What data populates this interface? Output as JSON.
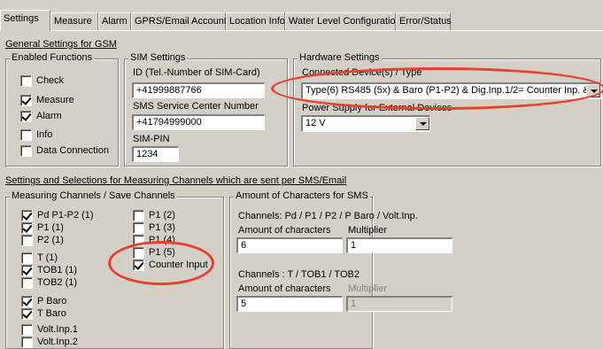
{
  "tabs": [
    {
      "label": "Settings",
      "active": true
    },
    {
      "label": "Measure"
    },
    {
      "label": "Alarm"
    },
    {
      "label": "GPRS/Email Account"
    },
    {
      "label": "Location Info"
    },
    {
      "label": "Water Level Configuration"
    },
    {
      "label": "Error/Status"
    }
  ],
  "general": {
    "title": "General Settings for GSM",
    "enabled_functions": {
      "label": "Enabled Functions",
      "items": [
        {
          "label": "Check",
          "checked": false
        },
        {
          "label": "Measure",
          "checked": true
        },
        {
          "label": "Alarm",
          "checked": true
        },
        {
          "label": "Info",
          "checked": false
        },
        {
          "label": "Data Connection",
          "checked": false
        }
      ]
    },
    "sim": {
      "label": "SIM Settings",
      "id_label": "ID (Tel.-Number of SIM-Card)",
      "id_value": "+41999887766",
      "smsc_label": "SMS Service Center Number",
      "smsc_value": "+41794999000",
      "pin_label": "SIM-PIN",
      "pin_value": "1234"
    },
    "hardware": {
      "label": "Hardware Settings",
      "device_label": "Connected Device(s) / Type",
      "device_value": "Type(6)  RS485 (5x) & Baro (P1-P2) & Dig.Inp.1/2= Counter Inp. & Volt.Inp.",
      "power_label": "Power Supply for External Devices",
      "power_value": "12 V"
    }
  },
  "sms": {
    "title": "Settings and Selections for Measuring Channels which are sent per SMS/Email",
    "channels": {
      "label": "Measuring Channels / Save Channels",
      "col1": [
        {
          "label": "Pd P1-P2 (1)",
          "checked": true
        },
        {
          "label": "P1 (1)",
          "checked": true
        },
        {
          "label": "P2 (1)",
          "checked": false
        },
        {
          "label": "T (1)",
          "checked": false
        },
        {
          "label": "TOB1 (1)",
          "checked": true
        },
        {
          "label": "TOB2 (1)",
          "checked": false
        },
        {
          "label": "P Baro",
          "checked": true
        },
        {
          "label": "T Baro",
          "checked": true
        },
        {
          "label": "Volt.Inp.1",
          "checked": false
        },
        {
          "label": "Volt.Inp.2",
          "checked": false
        }
      ],
      "col2": [
        {
          "label": "P1 (2)",
          "checked": false
        },
        {
          "label": "P1 (3)",
          "checked": false
        },
        {
          "label": "P1 (4)",
          "checked": false
        },
        {
          "label": "P1 (5)",
          "checked": false
        },
        {
          "label": "Counter Input",
          "checked": true
        }
      ]
    },
    "chars": {
      "label": "Amount of Characters for SMS",
      "group1_title": "Channels: Pd / P1 / P2 / P Baro / Volt.Inp.",
      "group1_amount_label": "Amount of characters",
      "group1_amount_value": "6",
      "group1_mult_label": "Multiplier",
      "group1_mult_value": "1",
      "group2_title": "Channels :  T / TOB1 / TOB2",
      "group2_amount_label": "Amount of characters",
      "group2_amount_value": "5",
      "group2_mult_label": "Multiplier",
      "group2_mult_value": "1"
    }
  },
  "colors": {
    "highlight": "#e8402a",
    "background": "#d4d0c8"
  }
}
